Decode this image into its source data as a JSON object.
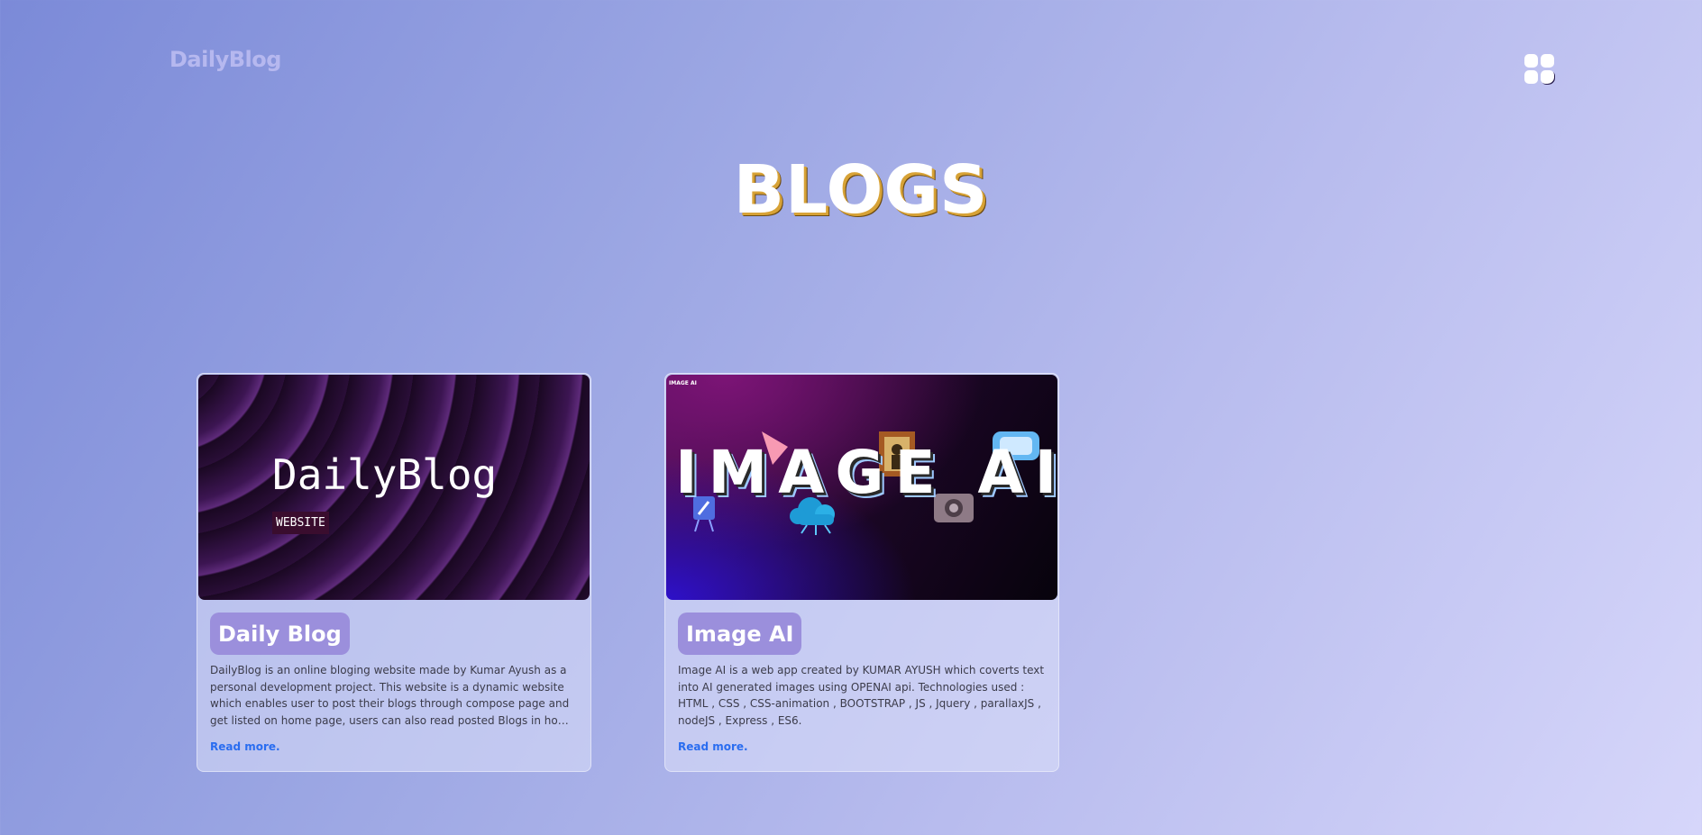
{
  "header": {
    "brand": "DailyBlog",
    "menu_icon": "grid-menu-icon"
  },
  "page": {
    "title": "BLOGS"
  },
  "cards": [
    {
      "image_text": "DailyBlog",
      "image_tag": "WEBSITE",
      "title": "Daily Blog",
      "description": "DailyBlog is an online bloging website made by Kumar Ayush as a personal development project. This website is a dynamic website which enables user to post their blogs through compose page and get listed on home page, users can also read posted Blogs in home page by clicking...",
      "link": "Read more."
    },
    {
      "image_label": "IMAGE AI",
      "image_text": "IMAGE AI",
      "title": "Image AI",
      "description": "Image AI is a web app created by KUMAR AYUSH which coverts text into AI generated images using OPENAI api. Technologies used : HTML , CSS , CSS-animation , BOOTSTRAP , JS , Jquery , parallaxJS , nodeJS , Express , ES6.",
      "link": "Read more."
    }
  ],
  "colors": {
    "accent": "#9b8fdc",
    "link": "#2a6df0",
    "title_shadow": "#d7a236"
  }
}
